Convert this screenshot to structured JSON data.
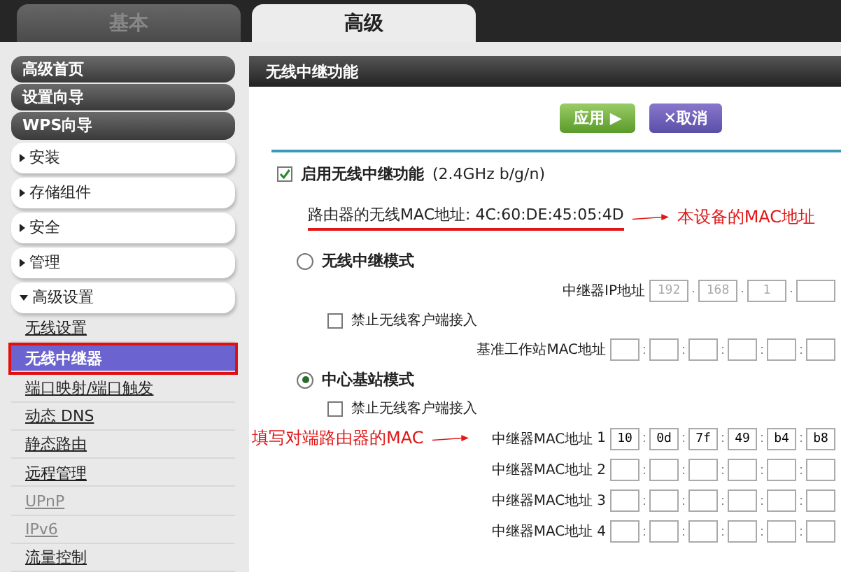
{
  "tabs": [
    {
      "label": "基本",
      "selected": false
    },
    {
      "label": "高级",
      "selected": true
    }
  ],
  "sidebar": {
    "items": [
      {
        "kind": "header",
        "label": "高级首页"
      },
      {
        "kind": "header",
        "label": "设置向导"
      },
      {
        "kind": "header",
        "label": "WPS向导"
      },
      {
        "kind": "group",
        "label": "安装",
        "expanded": false
      },
      {
        "kind": "group",
        "label": "存储组件",
        "expanded": false
      },
      {
        "kind": "group",
        "label": "安全",
        "expanded": false
      },
      {
        "kind": "group",
        "label": "管理",
        "expanded": false
      },
      {
        "kind": "group",
        "label": "高级设置",
        "expanded": true
      },
      {
        "kind": "link",
        "label": "无线设置",
        "selected": false,
        "disabled": false
      },
      {
        "kind": "link",
        "label": "无线中继器",
        "selected": true,
        "disabled": false
      },
      {
        "kind": "link",
        "label": "端口映射/端口触发",
        "selected": false,
        "disabled": false
      },
      {
        "kind": "link",
        "label": "动态 DNS",
        "selected": false,
        "disabled": false
      },
      {
        "kind": "link",
        "label": "静态路由",
        "selected": false,
        "disabled": false
      },
      {
        "kind": "link",
        "label": "远程管理",
        "selected": false,
        "disabled": false
      },
      {
        "kind": "link",
        "label": "UPnP",
        "selected": false,
        "disabled": true
      },
      {
        "kind": "link",
        "label": "IPv6",
        "selected": false,
        "disabled": true
      },
      {
        "kind": "link",
        "label": "流量控制",
        "selected": false,
        "disabled": false
      }
    ]
  },
  "panel": {
    "title": "无线中继功能",
    "buttons": [
      {
        "kind": "apply",
        "label": "应用 ▶"
      },
      {
        "kind": "cancel",
        "label": "✕取消"
      }
    ],
    "enable": {
      "label": "启用无线中继功能",
      "note": "(2.4GHz b/g/n)",
      "checked": true
    },
    "mac_line": {
      "label": "路由器的无线MAC地址:",
      "value": "4C:60:DE:45:05:4D"
    },
    "mac_annotation": "本设备的MAC地址",
    "repeater_mode": {
      "label": "无线中继模式",
      "selected": false,
      "ip_field": {
        "label": "中继器IP地址",
        "octets": [
          "192",
          "168",
          "1"
        ]
      },
      "block": {
        "label": "禁止无线客户端接入",
        "checked": false
      },
      "base_mac": {
        "label": "基准工作站MAC地址"
      }
    },
    "base_mode": {
      "label": "中心基站模式",
      "selected": true,
      "block": {
        "label": "禁止无线客户端接入",
        "checked": false
      },
      "annotation": "填写对端路由器的MAC",
      "repeater_macs": [
        {
          "label": "中继器MAC地址",
          "index": "1",
          "octets": [
            "10",
            "0d",
            "7f",
            "49",
            "b4",
            "b8"
          ]
        },
        {
          "label": "中继器MAC地址",
          "index": "2"
        },
        {
          "label": "中继器MAC地址",
          "index": "3"
        },
        {
          "label": "中继器MAC地址",
          "index": "4"
        }
      ]
    }
  }
}
